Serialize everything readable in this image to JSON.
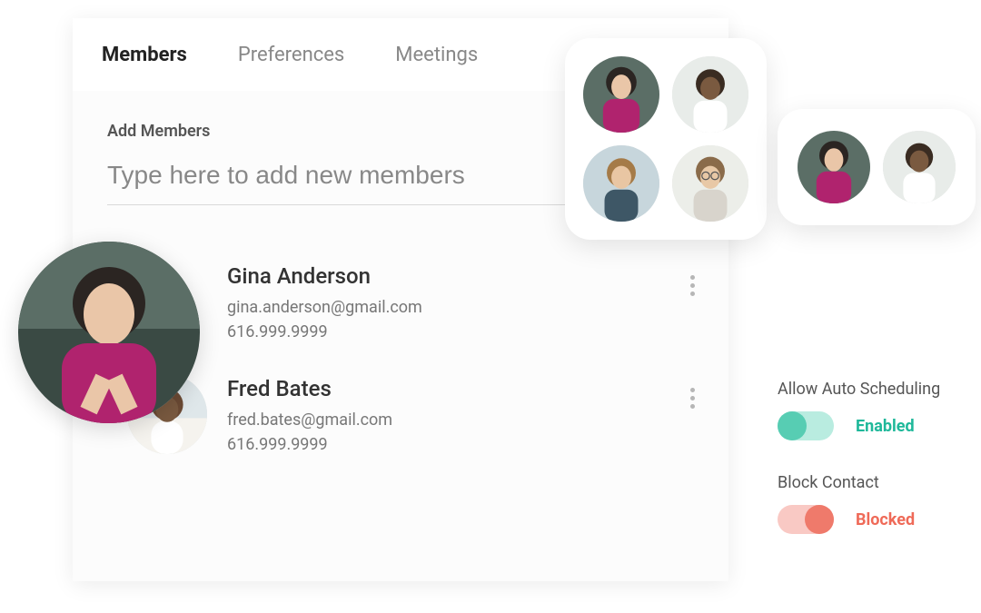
{
  "tabs": {
    "members": "Members",
    "preferences": "Preferences",
    "meetings": "Meetings"
  },
  "addMembers": {
    "label": "Add Members",
    "placeholder": "Type here to add new members"
  },
  "members": [
    {
      "name": "Gina Anderson",
      "email": "gina.anderson@gmail.com",
      "phone": "616.999.9999"
    },
    {
      "name": "Fred Bates",
      "email": "fred.bates@gmail.com",
      "phone": "616.999.9999"
    }
  ],
  "settings": {
    "autoSchedule": {
      "label": "Allow Auto Scheduling",
      "state": "Enabled"
    },
    "blockContact": {
      "label": "Block Contact",
      "state": "Blocked"
    }
  }
}
